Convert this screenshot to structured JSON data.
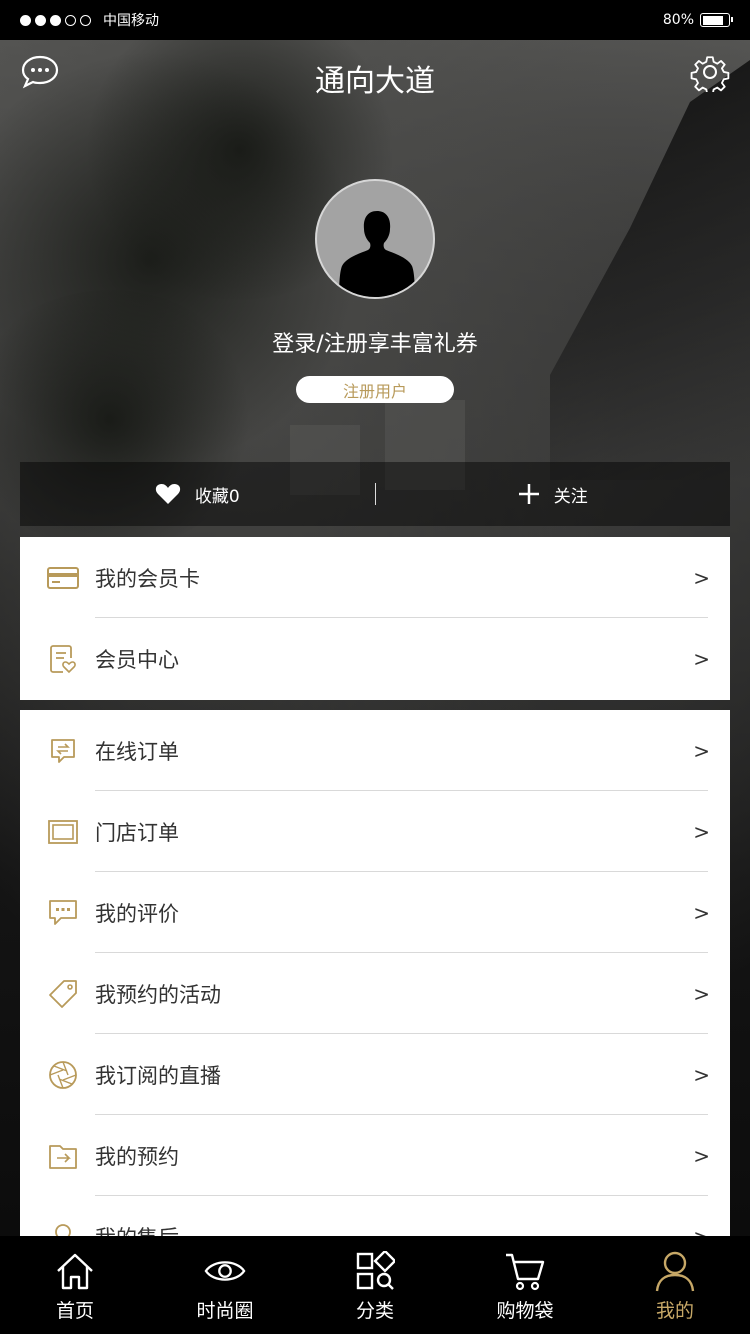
{
  "status_bar": {
    "carrier": "中国移动",
    "battery": "80%",
    "battery_level": 0.8
  },
  "header": {
    "title": "通向大道"
  },
  "profile": {
    "login_text": "登录/注册享丰富礼券",
    "register_label": "注册用户"
  },
  "stats": {
    "favorites_label": "收藏0",
    "follow_label": "关注"
  },
  "menu_group1": [
    {
      "label": "我的会员卡",
      "icon": "card-icon"
    },
    {
      "label": "会员中心",
      "icon": "member-icon"
    }
  ],
  "menu_group2": [
    {
      "label": "在线订单",
      "icon": "online-order-icon"
    },
    {
      "label": "门店订单",
      "icon": "store-order-icon"
    },
    {
      "label": "我的评价",
      "icon": "comment-icon"
    },
    {
      "label": "我预约的活动",
      "icon": "tag-icon"
    },
    {
      "label": "我订阅的直播",
      "icon": "aperture-icon"
    },
    {
      "label": "我的预约",
      "icon": "folder-icon"
    },
    {
      "label": "我的售后",
      "icon": "service-icon"
    }
  ],
  "chevron": ">",
  "tabs": [
    {
      "label": "首页",
      "icon": "home-icon"
    },
    {
      "label": "时尚圈",
      "icon": "eye-icon"
    },
    {
      "label": "分类",
      "icon": "category-icon"
    },
    {
      "label": "购物袋",
      "icon": "cart-icon"
    },
    {
      "label": "我的",
      "icon": "profile-icon",
      "active": true
    }
  ],
  "colors": {
    "accent": "#c7a867",
    "icon_gold": "#b89a5a"
  }
}
